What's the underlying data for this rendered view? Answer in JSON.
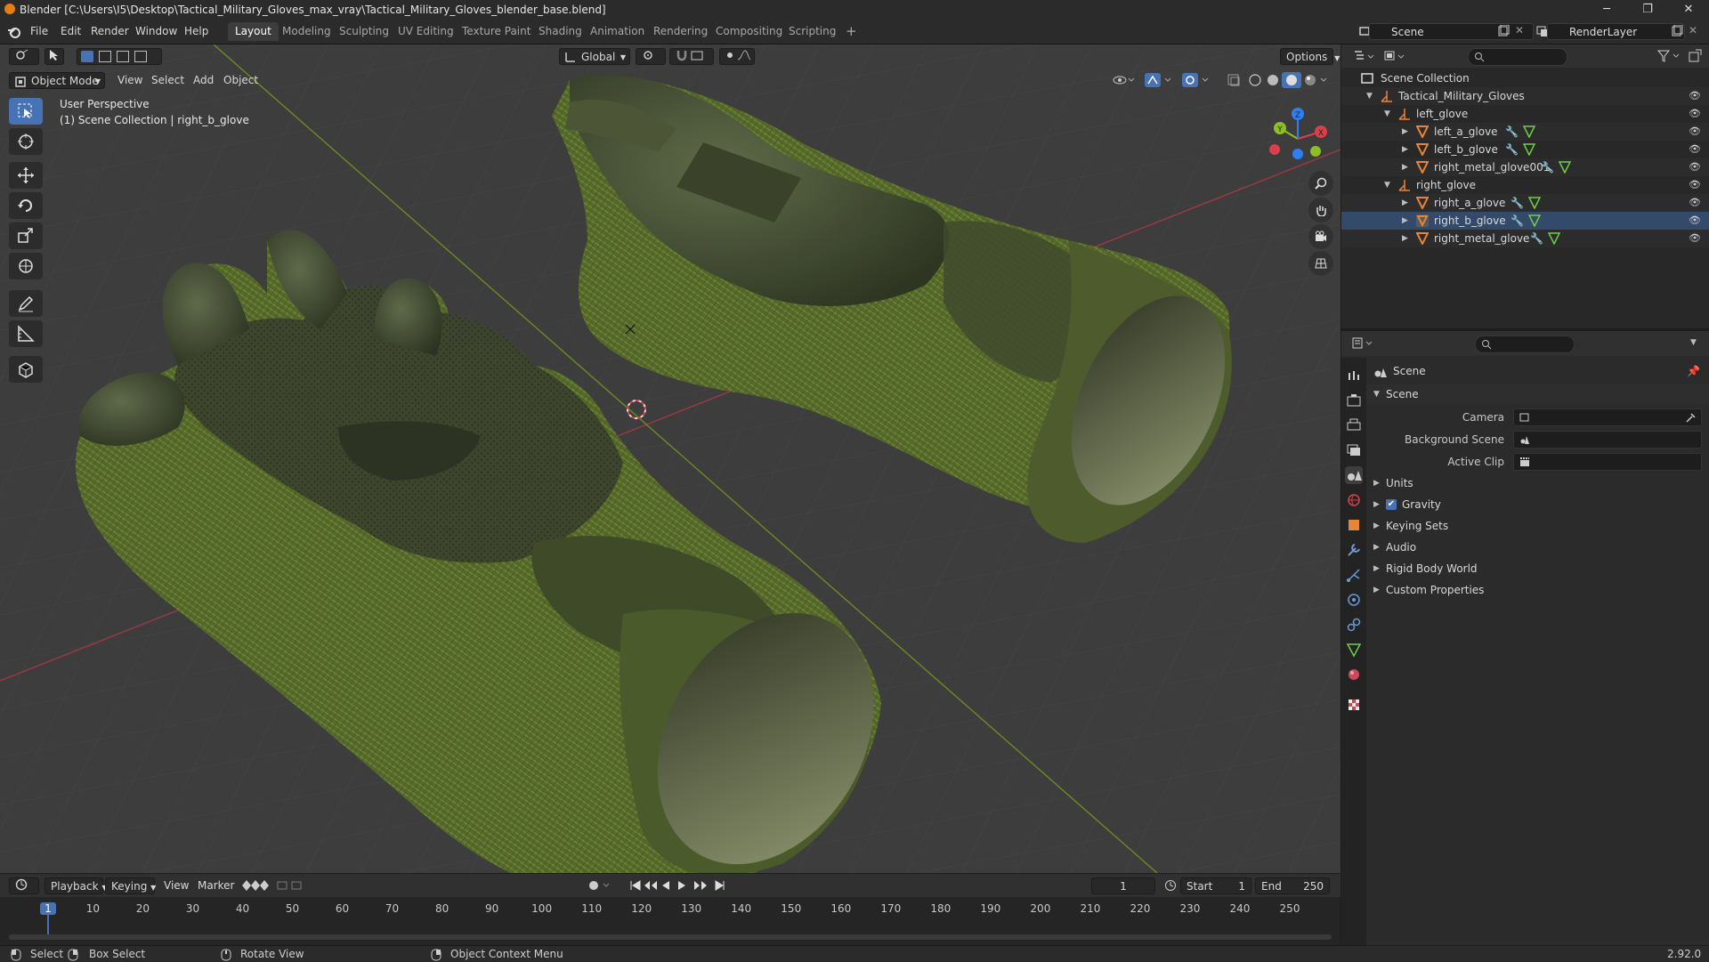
{
  "window": {
    "title": "Blender [C:\\Users\\I5\\Desktop\\Tactical_Military_Gloves_max_vray\\Tactical_Military_Gloves_blender_base.blend]",
    "minimize": "─",
    "maximize": "❐",
    "close": "✕"
  },
  "menu": {
    "file": "File",
    "edit": "Edit",
    "render": "Render",
    "window": "Window",
    "help": "Help"
  },
  "workspaces": [
    "Layout",
    "Modeling",
    "Sculpting",
    "UV Editing",
    "Texture Paint",
    "Shading",
    "Animation",
    "Rendering",
    "Compositing",
    "Scripting"
  ],
  "add_workspace": "+",
  "scene_name": "Scene",
  "view_layer": "RenderLayer",
  "viewport": {
    "transform_orientation": "Global",
    "options": "Options",
    "mode": "Object Mode",
    "menus": {
      "view": "View",
      "select": "Select",
      "add": "Add",
      "object": "Object"
    },
    "overlay_line1": "User Perspective",
    "overlay_line2": "(1) Scene Collection | right_b_glove",
    "gizmo": {
      "x": "X",
      "y": "Y",
      "z": "Z"
    }
  },
  "colors": {
    "accent": "#4772b3",
    "x_axis": "#d9404c",
    "y_axis": "#8cbf26",
    "z_axis": "#2f7ff0",
    "glove_green": "#5b6e2c",
    "leather": "#3b4527",
    "object_orange": "#e6843a"
  },
  "outliner": {
    "root": "Scene Collection",
    "items": [
      {
        "name": "Tactical_Military_Gloves"
      },
      {
        "name": "left_glove"
      },
      {
        "name": "left_a_glove"
      },
      {
        "name": "left_b_glove"
      },
      {
        "name": "right_metal_glove001"
      },
      {
        "name": "right_glove"
      },
      {
        "name": "right_a_glove"
      },
      {
        "name": "right_b_glove"
      },
      {
        "name": "right_metal_glove"
      }
    ]
  },
  "properties": {
    "context": "Scene",
    "panel": "Scene",
    "fields": {
      "camera": "Camera",
      "background_scene": "Background Scene",
      "active_clip": "Active Clip"
    },
    "sections": [
      "Units",
      "Gravity",
      "Keying Sets",
      "Audio",
      "Rigid Body World",
      "Custom Properties"
    ],
    "gravity_checked": true
  },
  "timeline": {
    "menus": {
      "playback": "Playback",
      "keying": "Keying",
      "view": "View",
      "marker": "Marker"
    },
    "current_frame": "1",
    "start_label": "Start",
    "start": "1",
    "end_label": "End",
    "end": "250",
    "ruler": [
      "1",
      "10",
      "20",
      "30",
      "40",
      "50",
      "60",
      "70",
      "80",
      "90",
      "100",
      "110",
      "120",
      "130",
      "140",
      "150",
      "160",
      "170",
      "180",
      "190",
      "200",
      "210",
      "220",
      "230",
      "240",
      "250"
    ]
  },
  "status": {
    "select": "Select",
    "box_select": "Box Select",
    "rotate_view": "Rotate View",
    "context_menu": "Object Context Menu",
    "version": "2.92.0"
  }
}
